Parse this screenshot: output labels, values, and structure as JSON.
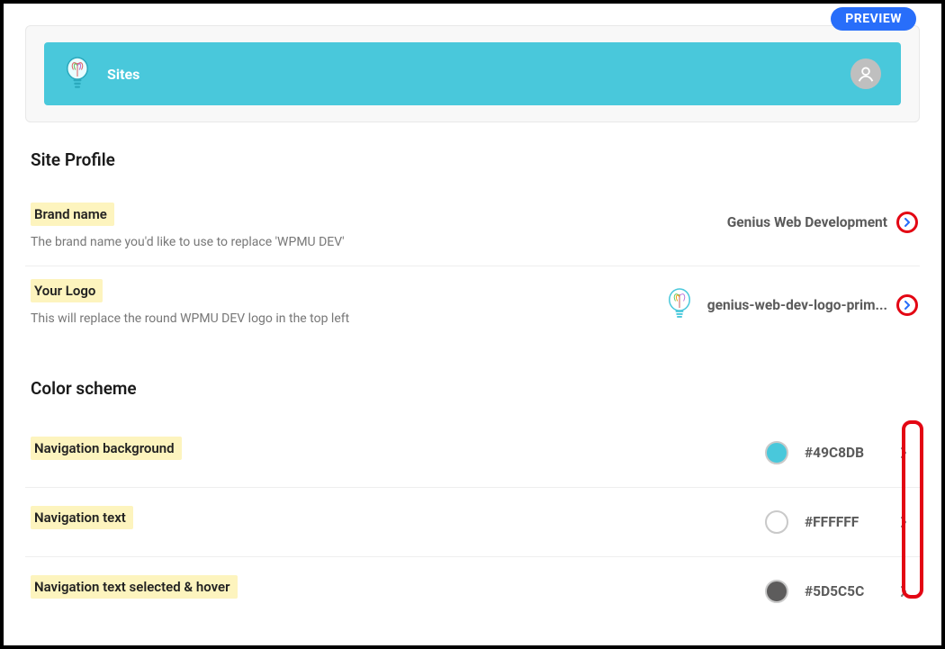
{
  "preview_badge": "PREVIEW",
  "navbar": {
    "title": "Sites"
  },
  "sections": {
    "site_profile": {
      "title": "Site Profile",
      "brand_name": {
        "label": "Brand name",
        "desc": "The brand name you'd like to use to replace 'WPMU DEV'",
        "value": "Genius Web Development"
      },
      "your_logo": {
        "label": "Your Logo",
        "desc": "This will replace the round WPMU DEV logo in the top left",
        "value": "genius-web-dev-logo-prim..."
      }
    },
    "color_scheme": {
      "title": "Color scheme",
      "items": [
        {
          "label": "Navigation background",
          "value": "#49C8DB",
          "swatch": "#49C8DB"
        },
        {
          "label": "Navigation text",
          "value": "#FFFFFF",
          "swatch": "#FFFFFF"
        },
        {
          "label": "Navigation text selected & hover",
          "value": "#5D5C5C",
          "swatch": "#5D5C5C"
        }
      ]
    }
  },
  "colors": {
    "accent": "#49C8DB",
    "highlight": "#fdf4be",
    "annotate": "#e30613",
    "badge": "#286efa"
  }
}
